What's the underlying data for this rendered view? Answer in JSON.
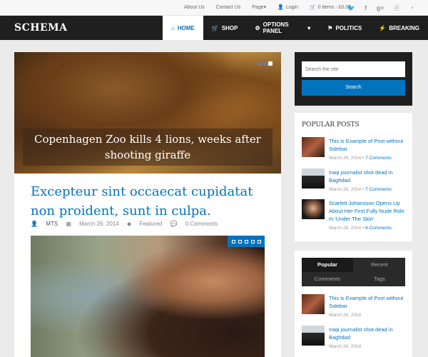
{
  "topbar": {
    "links": [
      "About Us",
      "Contact Us",
      "Page"
    ],
    "login": "Login",
    "cart": "0 items - £0.00",
    "social_icons": [
      "twitter-icon",
      "facebook-icon",
      "google-plus-icon",
      "pinterest-icon",
      "rss-icon"
    ]
  },
  "header": {
    "logo": "SCHEMA",
    "nav": [
      {
        "label": "HOME",
        "icon": "home-icon",
        "active": true
      },
      {
        "label": "SHOP",
        "icon": "cart-icon"
      },
      {
        "label": "OPTIONS PANEL",
        "icon": "gears-icon"
      },
      {
        "label": "POLITICS",
        "icon": "flag-icon"
      },
      {
        "label": "BREAKING",
        "icon": "bolt-icon"
      }
    ]
  },
  "hero": {
    "caption": "Copenhagen Zoo kills 4 lions, weeks after shooting giraffe"
  },
  "post": {
    "title": "Excepteur sint occaecat cupidatat non proident, sunt in culpa.",
    "author": "MTS",
    "date": "March 26, 2014",
    "category": "Featured",
    "comments": "0 Comments"
  },
  "search": {
    "placeholder": "Search the site",
    "button": "Search"
  },
  "popular": {
    "title": "POPULAR POSTS",
    "items": [
      {
        "title": "This is Example of Post without Sidebar",
        "date": "March 26, 2014",
        "comments": "7 Comments"
      },
      {
        "title": "Iraqi journalist shot dead in Baghdad",
        "date": "March 26, 2014",
        "comments": "7 Comments"
      },
      {
        "title": "Scarlett Johansson Opens Up About Her First Fully Nude Role In 'Under The Skin'",
        "date": "March 26, 2014",
        "comments": "6 Comments"
      }
    ]
  },
  "tabs_widget": {
    "tabs": [
      "Popular",
      "Recent",
      "Comments",
      "Tags"
    ],
    "items": [
      {
        "title": "This is Example of Post without Sidebar",
        "date": "March 26, 2014"
      },
      {
        "title": "Iraqi journalist shot dead in Baghdad",
        "date": "March 26, 2014"
      }
    ]
  }
}
